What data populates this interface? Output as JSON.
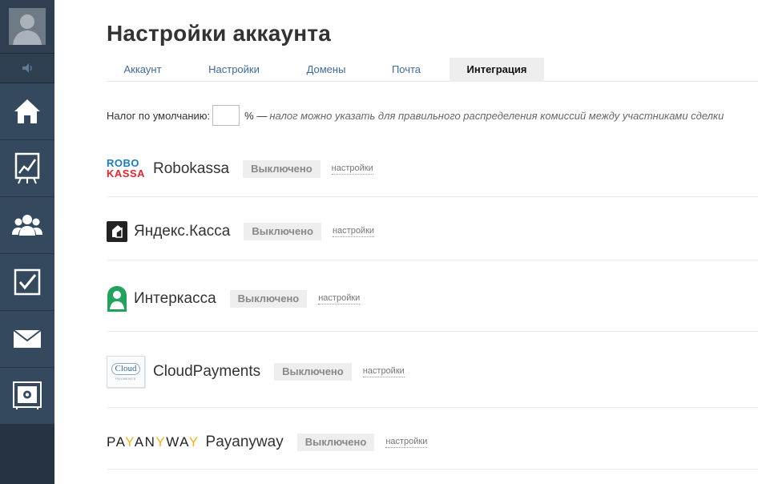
{
  "page": {
    "title": "Настройки аккаунта"
  },
  "tabs": [
    {
      "label": "Аккаунт",
      "active": false
    },
    {
      "label": "Настройки",
      "active": false
    },
    {
      "label": "Домены",
      "active": false
    },
    {
      "label": "Почта",
      "active": false
    },
    {
      "label": "Интеграция",
      "active": true
    }
  ],
  "tax": {
    "label": "Налог по умолчанию:",
    "value": "",
    "unit": "% —",
    "note": "налог можно указать для правильного распределения комиссий между участниками сделки"
  },
  "providers": [
    {
      "logo_top": "ROBO",
      "logo_bottom": "KASSA",
      "name": "Robokassa",
      "status": "Выключено",
      "settings_label": "настройки"
    },
    {
      "name": "Яндекс.Касса",
      "status": "Выключено",
      "settings_label": "настройки"
    },
    {
      "name": "Интеркасса",
      "status": "Выключено",
      "settings_label": "настройки"
    },
    {
      "logo_text": "Cloud",
      "logo_sub": "PAYMENTS",
      "name": "CloudPayments",
      "status": "Выключено",
      "settings_label": "настройки"
    },
    {
      "logo_text": "PAYANYWAY",
      "name": "Payanyway",
      "status": "Выключено",
      "settings_label": "настройки"
    }
  ],
  "sidebar": {
    "items": [
      {
        "icon": "avatar-icon"
      },
      {
        "icon": "sound-icon"
      },
      {
        "icon": "home-icon"
      },
      {
        "icon": "chart-icon"
      },
      {
        "icon": "users-icon"
      },
      {
        "icon": "tasks-icon"
      },
      {
        "icon": "mail-icon"
      },
      {
        "icon": "safe-icon"
      }
    ]
  },
  "colors": {
    "sidebar_bg": "#34495e",
    "link": "#3d6b9b",
    "robokassa_blue": "#1a7bbf",
    "robokassa_red": "#e3262f",
    "interkassa_green": "#21a35b",
    "payanyway_yellow": "#f3b31b"
  }
}
